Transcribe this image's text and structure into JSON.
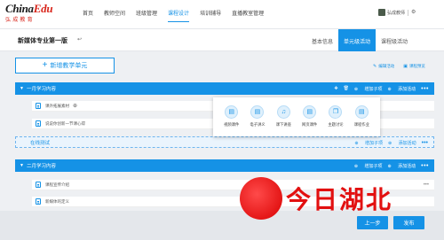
{
  "logo": {
    "brand_a": "China",
    "brand_b": "Edu",
    "cn": "弘成教育"
  },
  "nav": [
    "首页",
    "教师空间",
    "班级管理",
    "课程设计",
    "培训辅导",
    "直播教室管理"
  ],
  "nav_active": 3,
  "user": {
    "name": "弘成教师"
  },
  "course": {
    "title": "新媒体专业第一版"
  },
  "header_tabs": [
    {
      "label": "基本信息",
      "active": false
    },
    {
      "label": "单元级活动",
      "active": true
    },
    {
      "label": "课程级活动",
      "active": false
    }
  ],
  "add_unit": {
    "label": "新增教学单元",
    "plus": "+"
  },
  "top_links": {
    "edit": "编辑活动",
    "preview": "课程预览"
  },
  "sections": [
    {
      "title": "一月学习内容",
      "add_subsection": "增加子项",
      "add_activity": "添加活动",
      "lessons": [
        {
          "text": "课外拓展素材"
        },
        {
          "text": "说说你创新一节课心得"
        }
      ]
    },
    {
      "title": "二月学习内容",
      "add_subsection": "增加子项",
      "add_activity": "添加活动",
      "lessons": [
        {
          "text": "课程宣传介绍"
        },
        {
          "text": "新媒体的定义"
        }
      ]
    }
  ],
  "online_test": {
    "title": "在线测试",
    "add_subsection": "增加子项",
    "add_activity": "添加活动"
  },
  "activity_popup": [
    {
      "label": "视频课件",
      "icon": "video-doc-icon"
    },
    {
      "label": "电子讲义",
      "icon": "ebook-icon"
    },
    {
      "label": "课下讲座",
      "icon": "bell-icon"
    },
    {
      "label": "网页课件",
      "icon": "web-doc-icon"
    },
    {
      "label": "主题讨论",
      "icon": "discussion-icon"
    },
    {
      "label": "课程作业",
      "icon": "homework-icon"
    }
  ],
  "bottom": {
    "prev": "上一步",
    "publish": "发布"
  },
  "watermark": {
    "text": "今日湖北"
  },
  "colors": {
    "accent": "#1592e6",
    "brand_red": "#d9261c"
  }
}
